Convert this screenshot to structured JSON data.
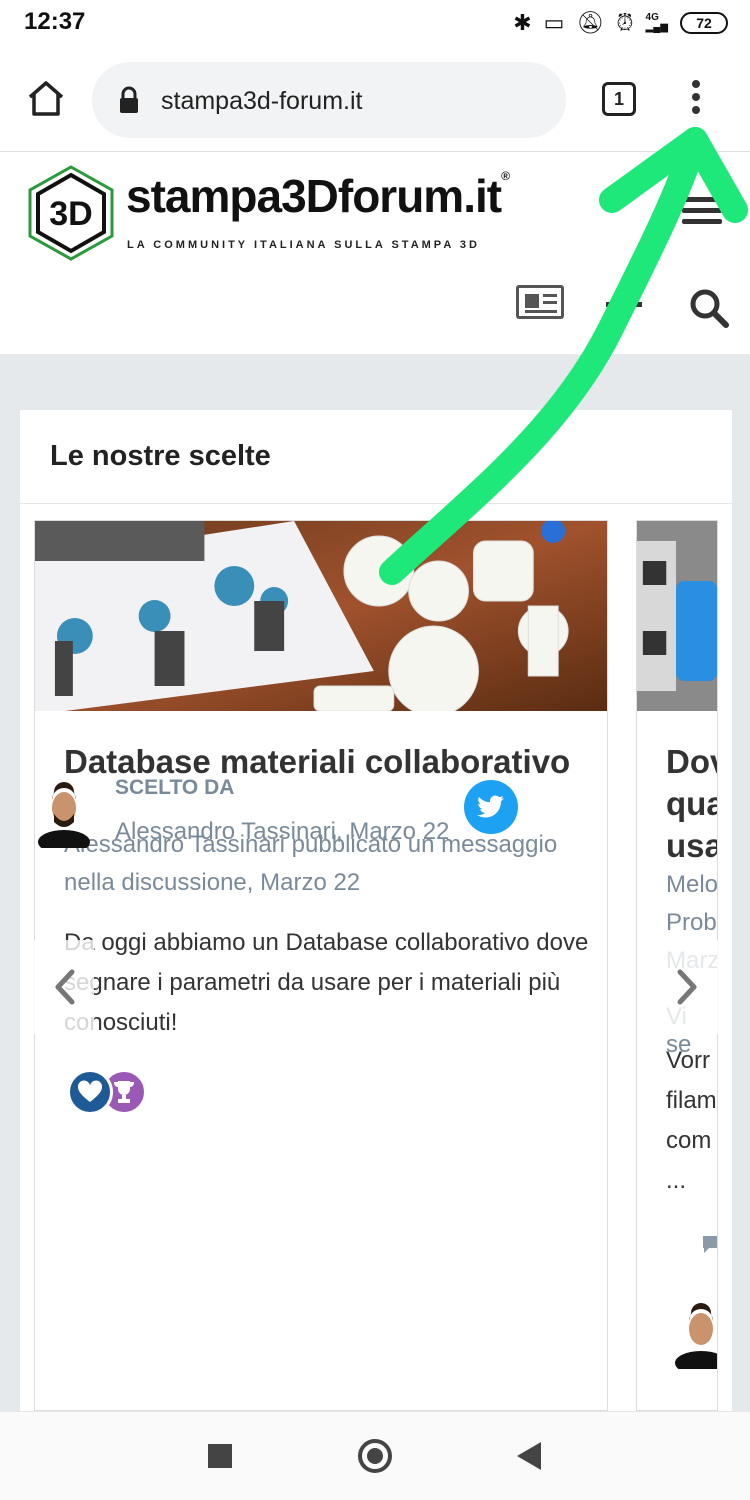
{
  "status_bar": {
    "time": "12:37",
    "network": "4G",
    "battery": "72"
  },
  "browser": {
    "url": "stampa3d-forum.it",
    "tab_count": "1"
  },
  "site": {
    "brand": "stampa3Dforum.it",
    "logo_mark": "3D",
    "tagline": "LA COMMUNITY ITALIANA SULLA STAMPA 3D"
  },
  "section": {
    "title": "Le nostre scelte"
  },
  "cards": [
    {
      "title": "Database materiali collaborativo",
      "meta": "Alessandro Tassinari pubblicato un messaggio nella discussione, Marzo 22",
      "body": "Da oggi abbiamo un Database collaborativo dove segnare i parametri da usare per i materiali più conosciuti!",
      "chosen_label": "SCELTO DA",
      "chosen_by": "Alessandro Tassinari, Marzo 22"
    },
    {
      "title": "Dov\nqua\nusa",
      "meta": "Melo\nProb\nMarz",
      "excerpt": "Vi se",
      "body": "Vorr\nfilam\ncom\n..."
    }
  ],
  "colors": {
    "accent_green": "#1ee87a",
    "meta_gray": "#7a8a9a",
    "twitter_blue": "#1da1f2",
    "like_blue": "#1d5a96",
    "trophy_purple": "#9b59b6"
  },
  "icons": [
    "home-icon",
    "lock-icon",
    "tabs-icon",
    "more-vert-icon",
    "hamburger-icon",
    "news-icon",
    "plus-icon",
    "search-icon",
    "heart-icon",
    "trophy-icon",
    "twitter-icon",
    "chevron-left-icon",
    "chevron-right-icon"
  ]
}
